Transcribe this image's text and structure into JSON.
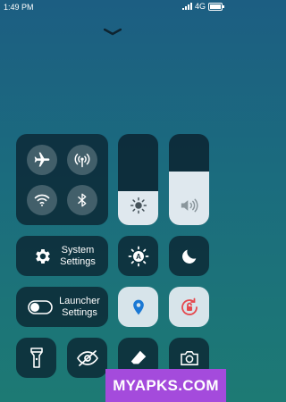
{
  "status_bar": {
    "time": "1:49 PM",
    "network": "4G",
    "icons": [
      "signal-icon",
      "battery-icon"
    ]
  },
  "handle_icon": "chevron-down-icon",
  "connectivity": {
    "airplane": {
      "icon": "airplane-icon"
    },
    "hotspot": {
      "icon": "hotspot-icon"
    },
    "wifi": {
      "icon": "wifi-icon"
    },
    "bluetooth": {
      "icon": "bluetooth-icon"
    }
  },
  "brightness_slider": {
    "icon": "sun-icon",
    "level": 0.37
  },
  "volume_slider": {
    "icon": "speaker-icon",
    "level": 0.59
  },
  "system_settings": {
    "line1": "System",
    "line2": "Settings",
    "icon": "gear-icon"
  },
  "auto_brightness": {
    "icon": "auto-brightness-icon",
    "letter": "A"
  },
  "night_mode": {
    "icon": "moon-icon"
  },
  "launcher_settings": {
    "line1": "Launcher",
    "line2": "Settings",
    "icon": "toggle-icon"
  },
  "location": {
    "icon": "location-pin-icon",
    "accent": "#1a78d4"
  },
  "rotation_lock": {
    "icon": "rotation-lock-icon",
    "accent": "#e5484d"
  },
  "bottom_row": [
    "flashlight-icon",
    "eye-off-icon",
    "eraser-icon",
    "camera-icon"
  ],
  "watermark": {
    "text": "MYAPKS.COM",
    "color": "#a44bdc"
  }
}
